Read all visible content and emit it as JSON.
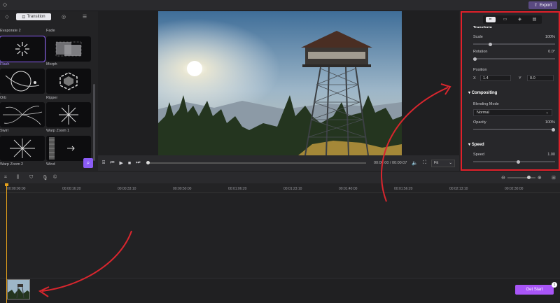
{
  "topbar": {
    "export_label": "Export"
  },
  "left_panel": {
    "tabs": [
      {
        "icon": "sparkle-icon",
        "label": ""
      },
      {
        "icon": "transition-icon",
        "label": "Transition"
      },
      {
        "icon": "target-icon",
        "label": ""
      },
      {
        "icon": "menu-icon",
        "label": ""
      }
    ],
    "transitions": [
      {
        "label": "Evaporate 2"
      },
      {
        "label": "Fade"
      },
      {
        "label": "Flash"
      },
      {
        "label": "Morph"
      },
      {
        "label": "Orb"
      },
      {
        "label": "Ripper"
      },
      {
        "label": "Swirl"
      },
      {
        "label": "Warp Zoom 1"
      },
      {
        "label": "Warp Zoom 2"
      },
      {
        "label": "Wind"
      }
    ]
  },
  "playbar": {
    "time": "00:00:00 / 00:00:07",
    "fit": "Fit"
  },
  "properties": {
    "partial_header": "Transform",
    "scale_label": "Scale",
    "scale_value": "100%",
    "scale_level": 0.2,
    "rotation_label": "Rotation",
    "rotation_value": "0.0°",
    "rotation_level": 0.0,
    "position_label": "Position",
    "x_label": "X",
    "x_value": "1.4",
    "y_label": "Y",
    "y_value": "0.0",
    "compositing_header": "Compositing",
    "blending_label": "Blending Mode",
    "blending_value": "Normal",
    "opacity_label": "Opacity",
    "opacity_value": "100%",
    "opacity_level": 1.0,
    "speed_header": "Speed",
    "speed_label": "Speed",
    "speed_value": "1.00",
    "speed_level": 0.55
  },
  "timeline": {
    "ticks": [
      "00:00:00:00",
      "00:00:16:20",
      "00:00:33:10",
      "00:00:50:00",
      "00:01:06:20",
      "00:01:23:10",
      "00:01:40:00",
      "00:01:56:20",
      "00:02:13:10",
      "00:02:30:00"
    ],
    "get_start_label": "Get Start",
    "badge": "1"
  },
  "colors": {
    "accent": "#8b5cf6",
    "highlight_border": "#e0202a",
    "playhead": "#e6a11b"
  }
}
